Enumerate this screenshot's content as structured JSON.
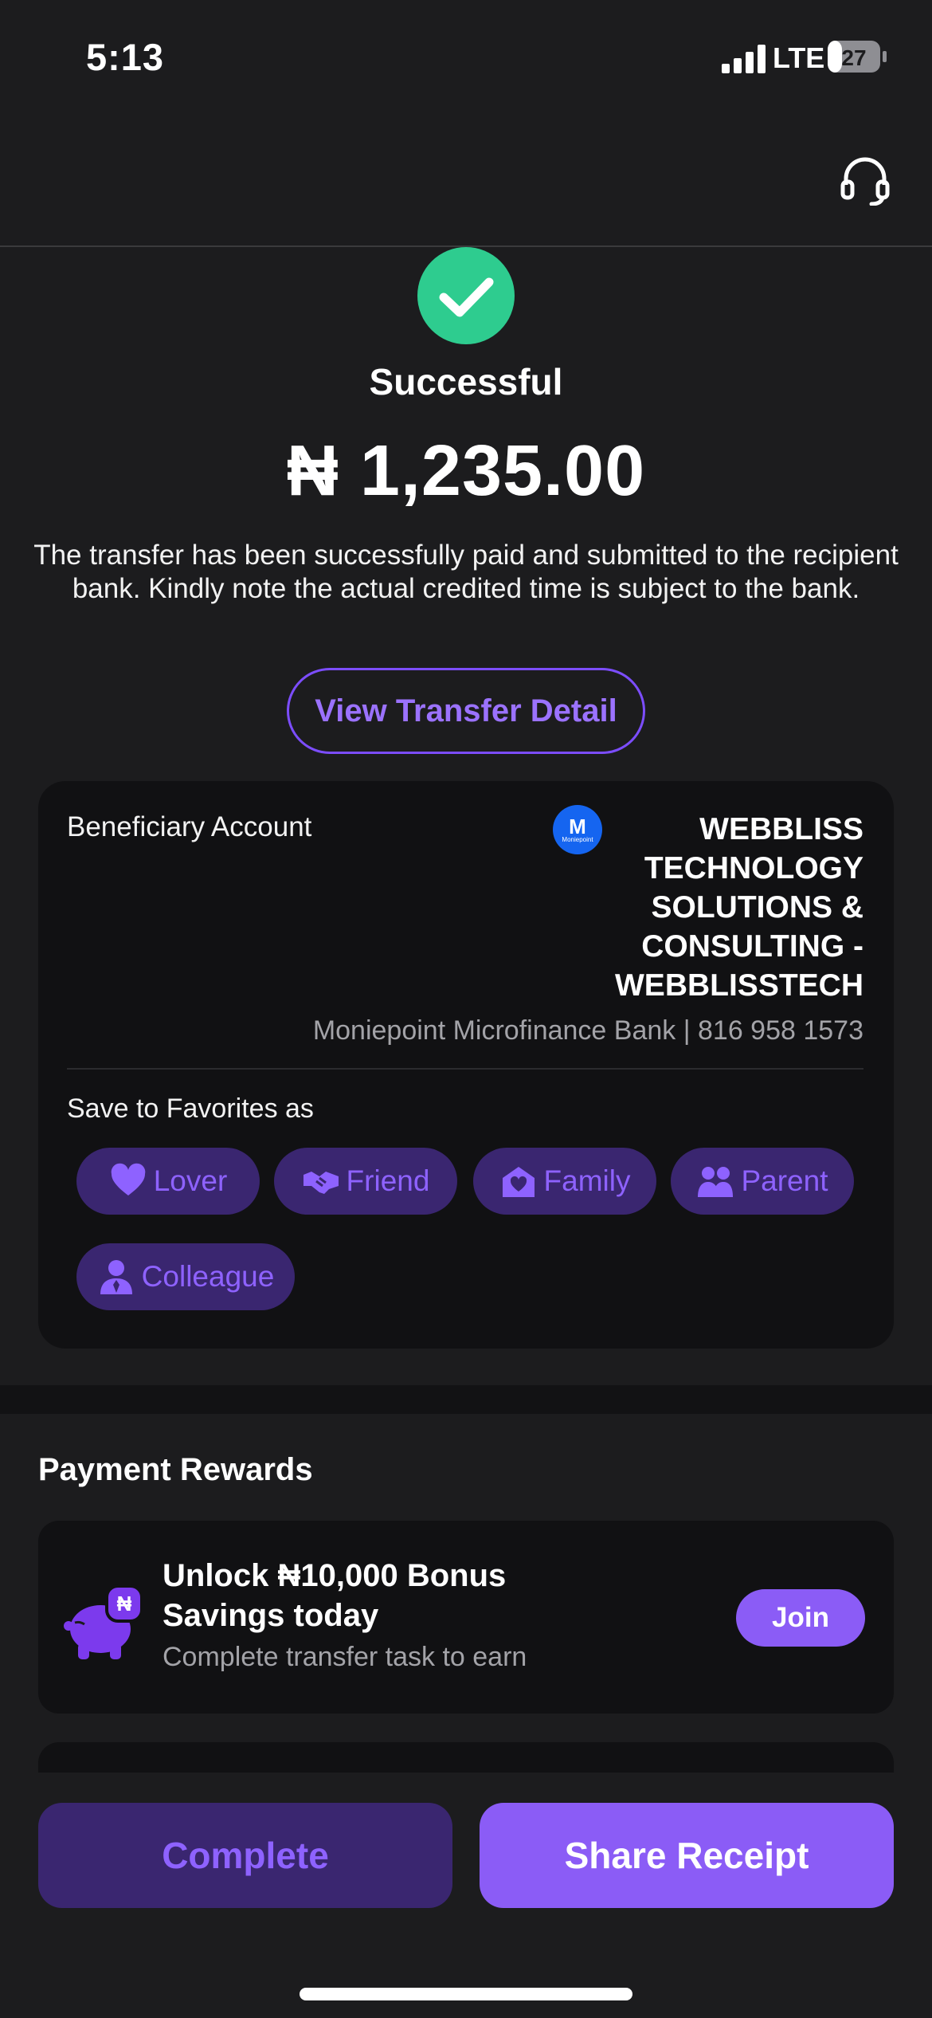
{
  "status_bar": {
    "time": "5:13",
    "network": "LTE",
    "battery": "27"
  },
  "success": {
    "icon": "check-circle-icon",
    "title": "Successful",
    "amount": "₦ 1,235.00",
    "message": "The transfer has been successfully paid and submitted to the recipient bank. Kindly note the actual credited time is subject to the bank.",
    "view_detail_label": "View Transfer Detail"
  },
  "beneficiary": {
    "label": "Beneficiary Account",
    "bank_logo_letter": "M",
    "bank_logo_text": "Moniepoint",
    "name": "WEBBLISS TECHNOLOGY SOLUTIONS & CONSULTING - WEBBLISSTECH",
    "bank_info": "Moniepoint Microfinance Bank | 816 958 1573"
  },
  "favorites": {
    "label": "Save to Favorites as",
    "chips": [
      {
        "label": "Lover",
        "icon": "heart-icon"
      },
      {
        "label": "Friend",
        "icon": "handshake-icon"
      },
      {
        "label": "Family",
        "icon": "home-heart-icon"
      },
      {
        "label": "Parent",
        "icon": "people-icon"
      },
      {
        "label": "Colleague",
        "icon": "person-tie-icon"
      }
    ]
  },
  "rewards": {
    "title": "Payment Rewards",
    "card": {
      "icon": "piggy-bank-icon",
      "badge": "₦",
      "headline": "Unlock ₦10,000 Bonus Savings today",
      "subtext": "Complete transfer task to earn",
      "join_label": "Join"
    }
  },
  "actions": {
    "complete_label": "Complete",
    "share_label": "Share Receipt"
  },
  "colors": {
    "accent": "#8b5cf6",
    "accent_dark": "#3a2670",
    "success": "#2ecc8f",
    "background": "#1c1c1e"
  }
}
